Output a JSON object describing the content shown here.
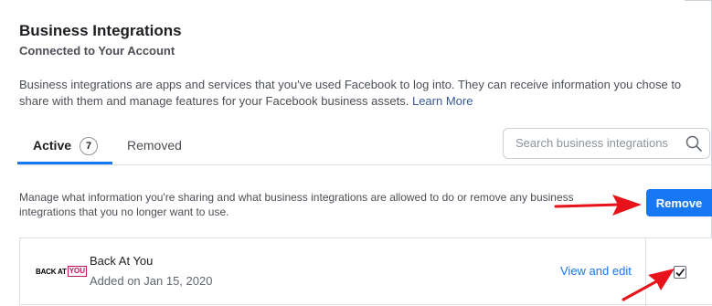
{
  "header": {
    "title": "Business Integrations",
    "subtitle": "Connected to Your Account",
    "description": "Business integrations are apps and services that you've used Facebook to log into. They can receive information you chose to share with them and manage features for your Facebook business assets.",
    "learn_more": "Learn More"
  },
  "tabs": [
    {
      "label": "Active",
      "count": "7",
      "selected": true
    },
    {
      "label": "Removed",
      "selected": false
    }
  ],
  "search": {
    "placeholder": "Search business integrations",
    "value": "",
    "icon": "search-icon"
  },
  "manage": {
    "text": "Manage what information you're sharing and what business integrations are allowed to do or remove any business integrations that you no longer want to use.",
    "remove_label": "Remove"
  },
  "integrations": [
    {
      "logo_text": [
        "BACK AT",
        "YOU"
      ],
      "name": "Back At You",
      "added": "Added on Jan 15, 2020",
      "action": "View and edit",
      "checked": true
    }
  ],
  "colors": {
    "accent": "#1877f2",
    "annotation_arrow": "#e8121b",
    "logo_accent": "#c2185b"
  }
}
